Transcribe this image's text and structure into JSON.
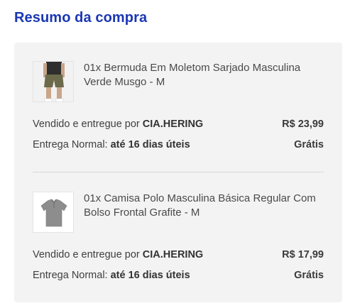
{
  "page": {
    "title": "Resumo da compra"
  },
  "items": [
    {
      "thumbnail": "shorts-product-image",
      "name": "01x Bermuda Em Moletom Sarjado Masculina Verde Musgo - M",
      "sold_by_label": "Vendido e entregue por",
      "seller": "CIA.HERING",
      "price": "R$ 23,99",
      "delivery_label": "Entrega Normal:",
      "delivery_time": "até 16 dias úteis",
      "delivery_price": "Grátis"
    },
    {
      "thumbnail": "polo-shirt-product-image",
      "name": "01x Camisa Polo Masculina Básica Regular Com Bolso Frontal Grafite - M",
      "sold_by_label": "Vendido e entregue por",
      "seller": "CIA.HERING",
      "price": "R$ 17,99",
      "delivery_label": "Entrega Normal:",
      "delivery_time": "até 16 dias úteis",
      "delivery_price": "Grátis"
    }
  ],
  "colors": {
    "title": "#1a37b3",
    "card_background": "#f3f3f4",
    "text": "#3a3a3a"
  }
}
